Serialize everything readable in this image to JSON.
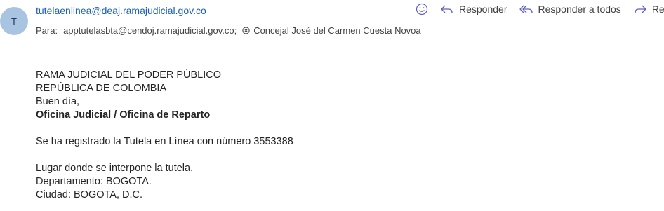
{
  "sender": {
    "avatar_initial": "T",
    "email": "tutelaenlinea@deaj.ramajudicial.gov.co"
  },
  "recipients": {
    "label": "Para:",
    "to1": "apptutelasbta@cendoj.ramajudicial.gov.co;",
    "to2": "Concejal José del Carmen Cuesta Novoa"
  },
  "actions": {
    "emoji_icon": "smiley-icon",
    "reply": "Responder",
    "reply_all": "Responder a todos",
    "forward": "Ree"
  },
  "body": {
    "line1": "RAMA JUDICIAL DEL PODER PÚBLICO",
    "line2": "REPÚBLICA DE COLOMBIA",
    "line3": "Buen día,",
    "line4": "Oficina Judicial / Oficina de Reparto",
    "line5": "Se ha registrado la Tutela en Línea con número 3553388",
    "line6": "Lugar donde se interpone la tutela.",
    "line7": "Departamento: BOGOTA.",
    "line8": "Ciudad: BOGOTA, D.C."
  },
  "colors": {
    "accent": "#1a5fb4",
    "avatar_bg": "#a9c4e0",
    "icon_purple": "#5b5fc7"
  }
}
